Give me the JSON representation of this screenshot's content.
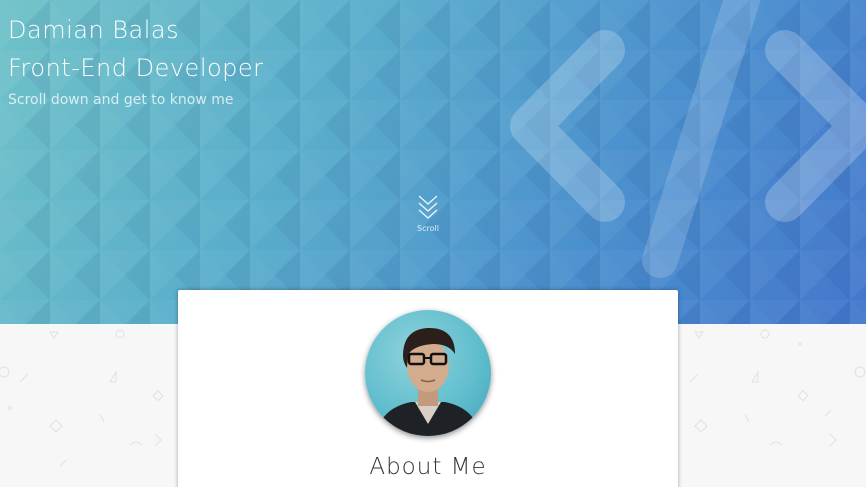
{
  "hero": {
    "name": "Damian Balas",
    "title": "Front-End Developer",
    "subtitle": "Scroll down and get to know me",
    "scroll_label": "Scroll",
    "icons": [
      "code-icon",
      "chevron-double-down-icon"
    ]
  },
  "about": {
    "heading": "About Me",
    "avatar_icon": "profile-photo"
  },
  "colors": {
    "hero_gradient_start": "#6fc2c8",
    "hero_gradient_end": "#4477cc",
    "background": "#f7f7f7",
    "card": "#ffffff",
    "heading_text": "#333333"
  }
}
